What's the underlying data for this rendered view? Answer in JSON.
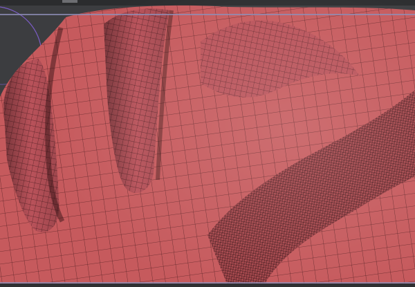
{
  "app": {
    "name": "",
    "view": "viewport"
  },
  "viewport": {
    "background_color": "#3c3d40",
    "mesh_fill_color": "#c65a5d",
    "mesh_wire_color": "#5a2326",
    "frame_line_color": "#8e8fb8",
    "gizmo_arc_color": "#7b5cc4",
    "wireframe": true
  }
}
